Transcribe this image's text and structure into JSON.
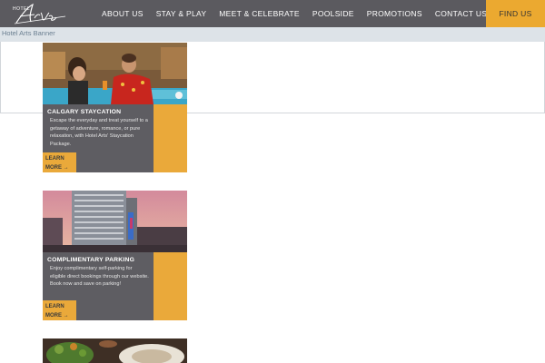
{
  "header": {
    "logo_small": "HOTEL",
    "logo_alt": "Hotel Arts logo",
    "nav": [
      "ABOUT US",
      "STAY & PLAY",
      "MEET & CELEBRATE",
      "POOLSIDE",
      "PROMOTIONS",
      "CONTACT US"
    ],
    "find_us": "FIND US"
  },
  "banner": {
    "label": "Hotel Arts Banner"
  },
  "cards": [
    {
      "title": "CALGARY STAYCATION",
      "text": "Escape the everyday and treat yourself to a getaway of adventure, romance, or pure relaxation, with Hotel Arts' Staycation Package.",
      "learn_1": "LEARN",
      "learn_2": "MORE",
      "arrow": "→",
      "image_icon": "couple-by-pool-photo"
    },
    {
      "title": "COMPLIMENTARY PARKING",
      "text": "Enjoy complimentary self-parking for eligible direct bookings through our website. Book now and save on parking!",
      "learn_1": "LEARN",
      "learn_2": "MORE",
      "arrow": "→",
      "image_icon": "hotel-tower-photo"
    },
    {
      "image_icon": "food-platter-photo"
    }
  ],
  "colors": {
    "header_bg": "#5b5a5f",
    "accent": "#eaa93a",
    "card_body": "#5e5d62"
  }
}
